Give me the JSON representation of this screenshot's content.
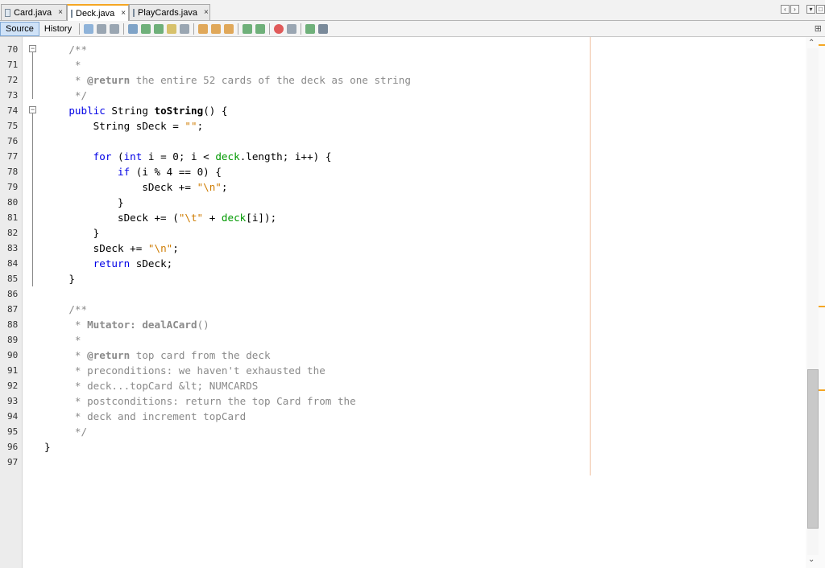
{
  "tabs": [
    {
      "label": "Card.java",
      "close": "×",
      "active": false
    },
    {
      "label": "Deck.java",
      "close": "×",
      "active": true
    },
    {
      "label": "PlayCards.java",
      "close": "×",
      "active": false
    }
  ],
  "toolbar": {
    "source_label": "Source",
    "history_label": "History"
  },
  "editor": {
    "lines": [
      {
        "n": "70",
        "text": "    /**",
        "fold": "−"
      },
      {
        "n": "71",
        "text": "     *"
      },
      {
        "n": "72",
        "text": "     * @return the entire 52 cards of the deck as one string"
      },
      {
        "n": "73",
        "text": "     */"
      },
      {
        "n": "74",
        "text": "    public String toString() {",
        "fold": "−"
      },
      {
        "n": "75",
        "text": "        String sDeck = \"\";"
      },
      {
        "n": "76",
        "text": ""
      },
      {
        "n": "77",
        "text": "        for (int i = 0; i < deck.length; i++) {"
      },
      {
        "n": "78",
        "text": "            if (i % 4 == 0) {"
      },
      {
        "n": "79",
        "text": "                sDeck += \"\\n\";"
      },
      {
        "n": "80",
        "text": "            }"
      },
      {
        "n": "81",
        "text": "            sDeck += (\"\\t\" + deck[i]);"
      },
      {
        "n": "82",
        "text": "        }"
      },
      {
        "n": "83",
        "text": "        sDeck += \"\\n\";"
      },
      {
        "n": "84",
        "text": "        return sDeck;"
      },
      {
        "n": "85",
        "text": "    }"
      },
      {
        "n": "86",
        "text": ""
      },
      {
        "n": "87",
        "text": "    /**"
      },
      {
        "n": "88",
        "text": "     * Mutator: dealACard()"
      },
      {
        "n": "89",
        "text": "     *"
      },
      {
        "n": "90",
        "text": "     * @return top card from the deck"
      },
      {
        "n": "91",
        "text": "     * preconditions: we haven't exhausted the"
      },
      {
        "n": "92",
        "text": "     * deck...topCard &lt; NUMCARDS"
      },
      {
        "n": "93",
        "text": "     * postconditions: return the top Card from the"
      },
      {
        "n": "94",
        "text": "     * deck and increment topCard"
      },
      {
        "n": "95",
        "text": "     */"
      },
      {
        "n": "96",
        "text": "}"
      },
      {
        "n": "97",
        "text": ""
      }
    ]
  },
  "colors": {
    "keyword": "#0000e6",
    "string": "#ce7b00",
    "field": "#009900",
    "comment": "#8a8a8a",
    "accent": "#f5a623"
  }
}
